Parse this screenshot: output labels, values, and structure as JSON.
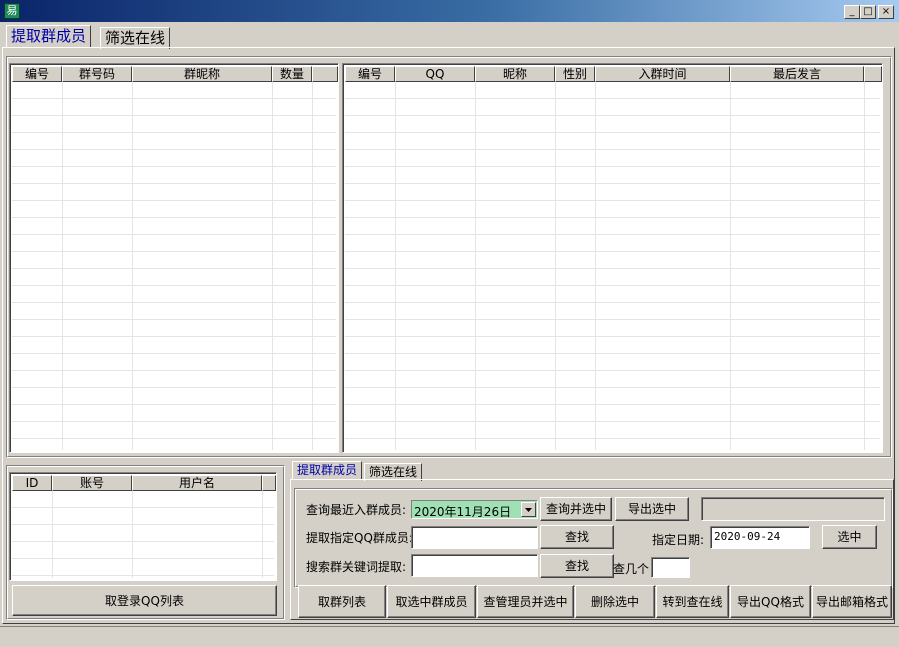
{
  "window": {
    "title": "",
    "icon_glyph": "易",
    "minimize_glyph": "_",
    "maximize_glyph": "□",
    "close_glyph": "×"
  },
  "tabs": [
    {
      "label": "提取群成员",
      "active": true
    },
    {
      "label": "筛选在线",
      "active": false
    }
  ],
  "group_list": {
    "columns": [
      "编号",
      "群号码",
      "群昵称",
      "数量"
    ]
  },
  "member_list": {
    "columns": [
      "编号",
      "QQ",
      "昵称",
      "性别",
      "入群时间",
      "最后发言"
    ]
  },
  "account_list": {
    "columns": [
      "ID",
      "账号",
      "用户名"
    ],
    "button": "取登录QQ列表"
  },
  "sub_tabs": [
    {
      "label": "提取群成员",
      "active": true
    },
    {
      "label": "筛选在线",
      "active": false
    }
  ],
  "form": {
    "recent_label": "查询最近入群成员:",
    "recent_date": "2020年11月26日",
    "query_select_btn": "查询并选中",
    "export_selected_btn": "导出选中",
    "extract_label": "提取指定QQ群成员:",
    "find_btn_1": "查找",
    "date_label": "指定日期:",
    "date_value": "2020-09-24",
    "select_btn": "选中",
    "keyword_label": "搜索群关键词提取:",
    "find_btn_2": "查找",
    "count_label": "查几个"
  },
  "actions": [
    "取群列表",
    "取选中群成员",
    "查管理员并选中",
    "删除选中",
    "转到查在线",
    "导出QQ格式",
    "导出邮箱格式"
  ],
  "colors": {
    "date_bg": "#9fe0b4",
    "active_tab": "#0000a8"
  }
}
